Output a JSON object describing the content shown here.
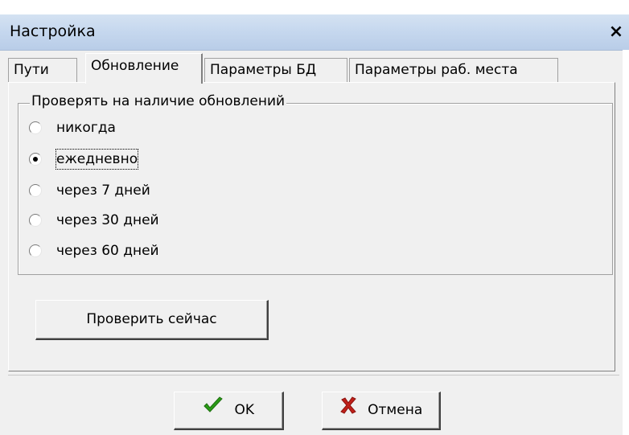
{
  "window": {
    "title": "Настройка",
    "close_symbol": "×"
  },
  "tabs": [
    {
      "label": "Пути",
      "active": false
    },
    {
      "label": "Обновление",
      "active": true
    },
    {
      "label": "Параметры БД",
      "active": false
    },
    {
      "label": "Параметры раб. места",
      "active": false
    }
  ],
  "update_group": {
    "legend": "Проверять на наличие обновлений",
    "options": [
      {
        "label": "никогда",
        "selected": false
      },
      {
        "label": "ежедневно",
        "selected": true
      },
      {
        "label": "через 7 дней",
        "selected": false
      },
      {
        "label": "через 30 дней",
        "selected": false
      },
      {
        "label": "через 60 дней",
        "selected": false
      }
    ]
  },
  "buttons": {
    "check_now": "Проверить сейчас",
    "ok": "OK",
    "cancel": "Отмена"
  },
  "icons": {
    "ok_icon": "check-icon",
    "cancel_icon": "cross-icon",
    "ok_color": "#2a9b16",
    "cancel_color": "#c0201a"
  }
}
